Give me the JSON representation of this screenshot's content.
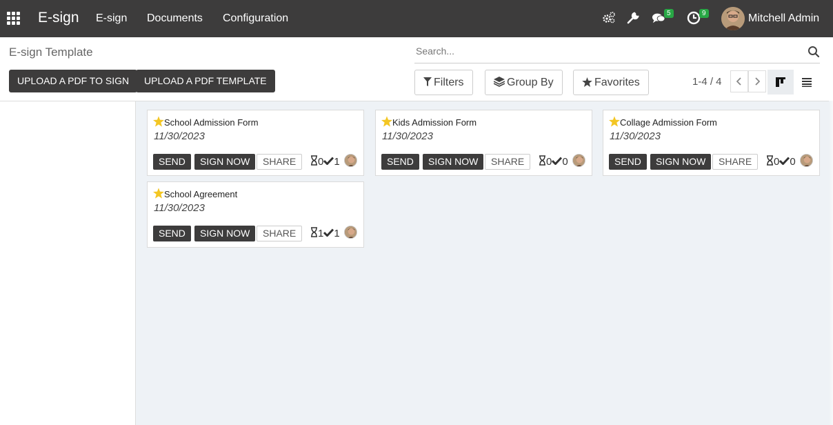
{
  "navbar": {
    "brand": "E-sign",
    "menu": [
      "E-sign",
      "Documents",
      "Configuration"
    ],
    "messages_badge": "5",
    "activities_badge": "9",
    "user_name": "Mitchell Admin"
  },
  "control_panel": {
    "breadcrumb": "E-sign Template",
    "search_placeholder": "Search...",
    "upload_pdf_to_sign": "UPLOAD A PDF TO SIGN",
    "upload_pdf_template": "UPLOAD A PDF TEMPLATE",
    "filters": "Filters",
    "group_by": "Group By",
    "favorites": "Favorites",
    "pager": "1-4 / 4"
  },
  "cards": [
    {
      "title": "School Admission Form",
      "date": "11/30/2023",
      "pending": "0",
      "done": "1"
    },
    {
      "title": "Kids Admission Form",
      "date": "11/30/2023",
      "pending": "0",
      "done": "0"
    },
    {
      "title": "Collage Admission Form",
      "date": "11/30/2023",
      "pending": "0",
      "done": "0"
    },
    {
      "title": "School Agreement",
      "date": "11/30/2023",
      "pending": "1",
      "done": "1"
    }
  ],
  "card_actions": {
    "send": "SEND",
    "sign_now": "SIGN NOW",
    "share": "SHARE"
  },
  "colors": {
    "navbar": "#3d3c3c",
    "badge": "#28a745",
    "star": "#f3c623",
    "background": "#eef2f6"
  }
}
